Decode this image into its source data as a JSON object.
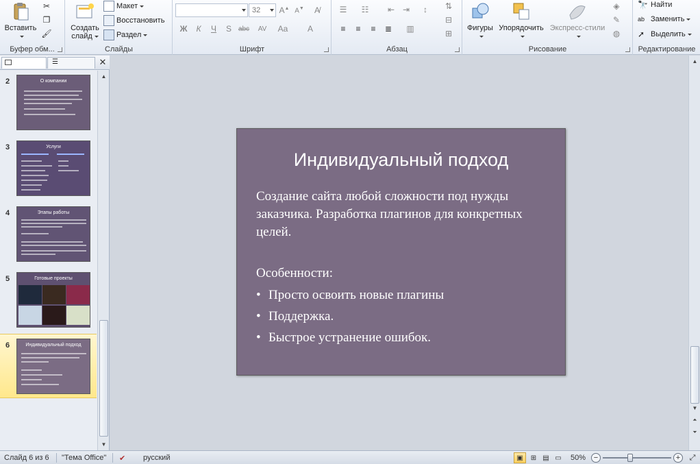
{
  "ribbon": {
    "clipboard": {
      "paste_label": "Вставить",
      "group_label": "Буфер обм..."
    },
    "slides": {
      "new_slide_label": "Создать слайд",
      "layout_label": "Макет",
      "reset_label": "Восстановить",
      "section_label": "Раздел",
      "group_label": "Слайды"
    },
    "font": {
      "font_name": "",
      "font_size": "32",
      "group_label": "Шрифт"
    },
    "paragraph": {
      "group_label": "Абзац"
    },
    "drawing": {
      "shapes_label": "Фигуры",
      "arrange_label": "Упорядочить",
      "quick_styles_label": "Экспресс-стили",
      "group_label": "Рисование"
    },
    "editing": {
      "find_label": "Найти",
      "replace_label": "Заменить",
      "select_label": "Выделить",
      "group_label": "Редактирование"
    }
  },
  "thumbnails": [
    {
      "number": "2",
      "title": "О компании"
    },
    {
      "number": "3",
      "title": "Услуги"
    },
    {
      "number": "4",
      "title": "Этапы работы"
    },
    {
      "number": "5",
      "title": "Готовые проекты"
    },
    {
      "number": "6",
      "title": "Индивидуальный подход"
    }
  ],
  "slide": {
    "title": "Индивидуальный подход",
    "paragraph": "Создание сайта любой сложности под нужды заказчика. Разработка плагинов для конкретных целей.",
    "features_heading": "Особенности:",
    "bullets": [
      "Просто освоить новые плагины",
      "Поддержка.",
      "Быстрое устранение ошибок."
    ],
    "background_color": "#7b6c84"
  },
  "status": {
    "slide_info": "Слайд 6 из 6",
    "theme": "\"Тема Office\"",
    "language": "русский",
    "zoom": "50%",
    "zoom_level_fraction": 0.5
  }
}
